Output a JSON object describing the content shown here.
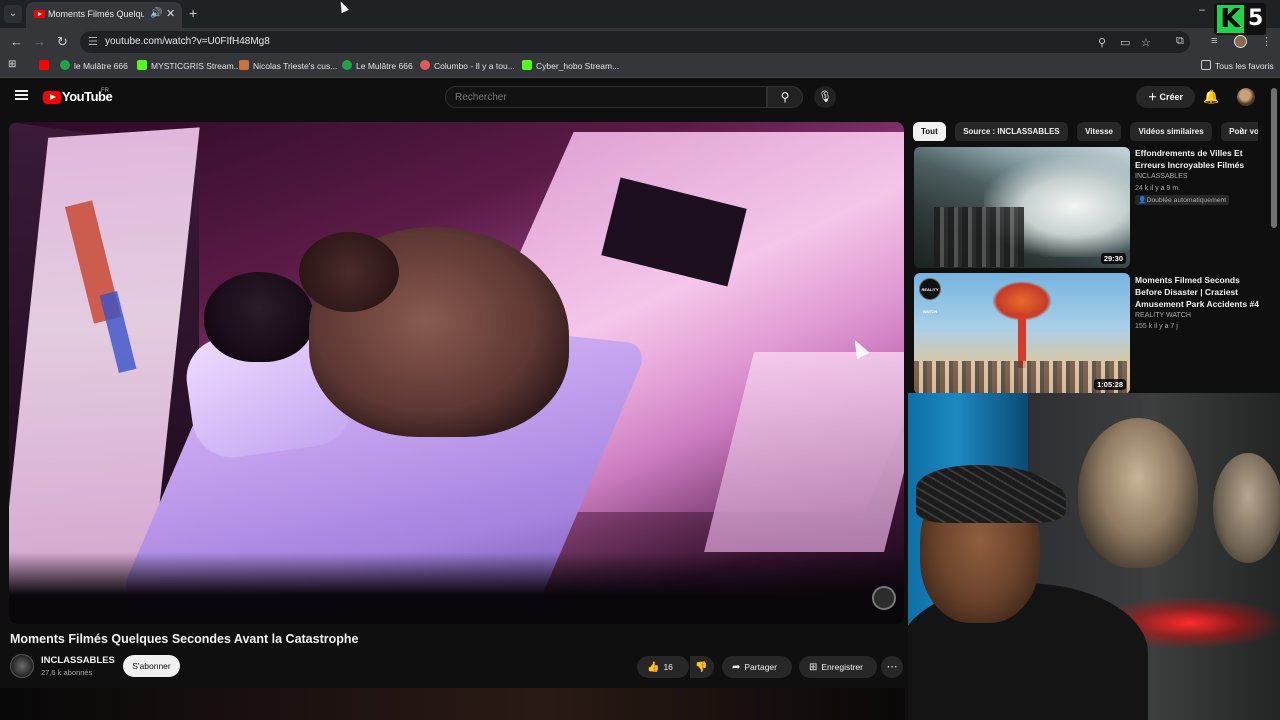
{
  "browser": {
    "tab_title": "Moments Filmés Quelques Secondes Avant la Catastrophe",
    "url": "youtube.com/watch?v=U0FIfH48Mg8",
    "bookmarks": [
      {
        "label": "le Mulâtre 666",
        "color": "#1ea446"
      },
      {
        "label": "MYSTICGRIS Stream...",
        "color": "#53fc18"
      },
      {
        "label": "Nicolas Trieste's cus...",
        "color": "#c9743a"
      },
      {
        "label": "Le Mulâtre 666",
        "color": "#1ea446"
      },
      {
        "label": "Columbo - Il y a tou...",
        "color": "#e05a5a"
      },
      {
        "label": "Cyber_hobo Stream...",
        "color": "#53fc18"
      }
    ],
    "all_bookmarks_label": "Tous les favoris"
  },
  "youtube": {
    "logo_text": "YouTube",
    "country_code": "FR",
    "search_placeholder": "Rechercher",
    "create_label": "Créer",
    "video": {
      "title": "Moments Filmés Quelques Secondes Avant la Catastrophe",
      "channel": "INCLASSABLES",
      "subscribers": "27,6 k abonnés",
      "subscribe_label": "S'abonner",
      "likes": "16",
      "share_label": "Partager",
      "save_label": "Enregistrer"
    },
    "chips": [
      "Tout",
      "Source : INCLASSABLES",
      "Vitesse",
      "Vidéos similaires",
      "Pour vous"
    ],
    "related": [
      {
        "title": "Effondrements de Villes Et Erreurs Incroyables Filmés",
        "channel": "INCLASSABLES",
        "meta": "24 k  il y a 9 m.",
        "badge": "Doublée automatiquement",
        "duration": "29:30"
      },
      {
        "title": "Moments Filmed Seconds Before Disaster | Craziest Amusement Park Accidents #4",
        "channel": "REALITY WATCH",
        "meta": "155 k  il y a 7 j",
        "duration": "1:05:28",
        "thumb_logo": "REALITY WATCH"
      }
    ]
  },
  "overlay": {
    "logo_letter": "K",
    "logo_number": "5"
  },
  "colors": {
    "youtube_red": "#ff0000",
    "kick_green": "#1fd34a",
    "bg": "#0f0f0f"
  }
}
